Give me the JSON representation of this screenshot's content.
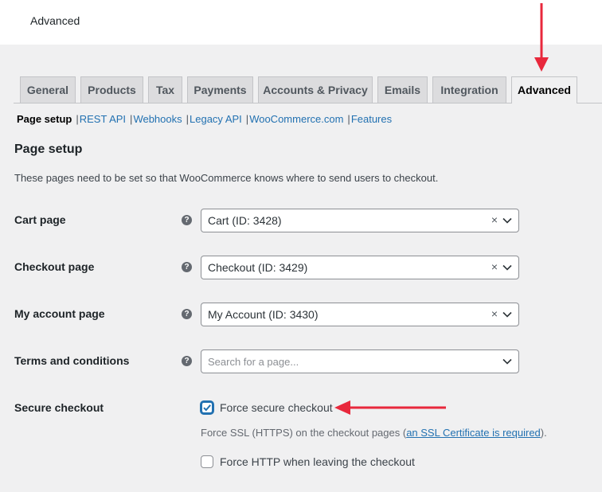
{
  "header": {
    "title": "Advanced"
  },
  "tabs": [
    {
      "label": "General"
    },
    {
      "label": "Products"
    },
    {
      "label": "Tax"
    },
    {
      "label": "Payments"
    },
    {
      "label": "Accounts & Privacy"
    },
    {
      "label": "Emails"
    },
    {
      "label": "Integration"
    },
    {
      "label": "Advanced",
      "active": true
    }
  ],
  "subnav": [
    {
      "label": "Page setup",
      "current": true
    },
    {
      "label": "REST API"
    },
    {
      "label": "Webhooks"
    },
    {
      "label": "Legacy API"
    },
    {
      "label": "WooCommerce.com"
    },
    {
      "label": "Features"
    }
  ],
  "subnav_separator": "|",
  "section": {
    "title": "Page setup",
    "description": "These pages need to be set so that WooCommerce knows where to send users to checkout."
  },
  "fields": {
    "cart_page": {
      "label": "Cart page",
      "value": "Cart (ID: 3428)"
    },
    "checkout_page": {
      "label": "Checkout page",
      "value": "Checkout (ID: 3429)"
    },
    "myaccount_page": {
      "label": "My account page",
      "value": "My Account (ID: 3430)"
    },
    "terms_page": {
      "label": "Terms and conditions",
      "placeholder": "Search for a page..."
    },
    "secure_checkout": {
      "label": "Secure checkout",
      "force_secure_label": "Force secure checkout",
      "force_secure_checked": true,
      "desc_before": "Force SSL (HTTPS) on the checkout pages (",
      "desc_link": "an SSL Certificate is required",
      "desc_after": ").",
      "force_http_label": "Force HTTP when leaving the checkout",
      "force_http_checked": false
    }
  },
  "icons": {
    "help": "?",
    "clear": "×",
    "chevron": "chevron-down-icon"
  },
  "colors": {
    "accent": "#2271b1",
    "annotation_arrow": "#e8283c",
    "page_bg": "#f0f0f1"
  }
}
